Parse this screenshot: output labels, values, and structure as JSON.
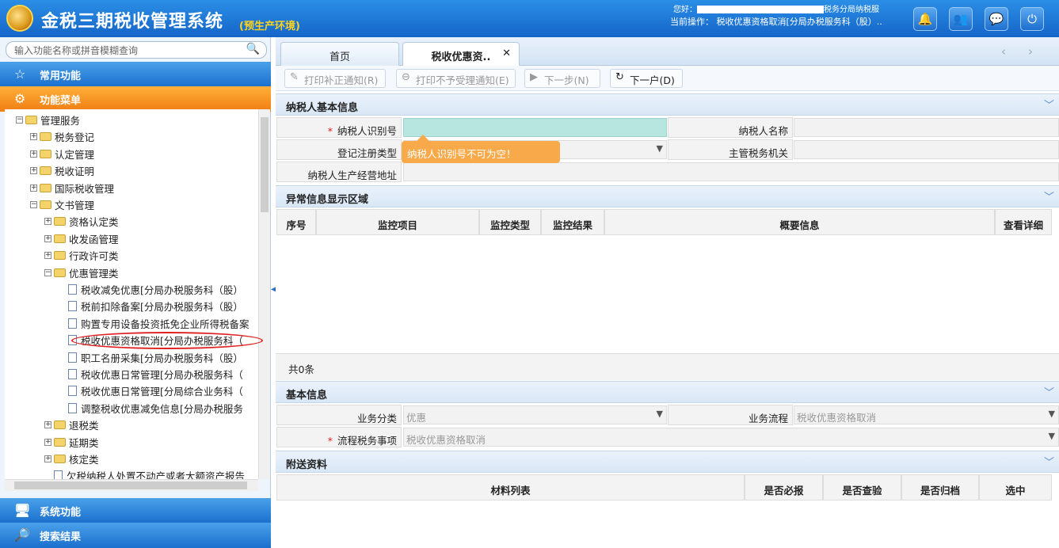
{
  "header": {
    "app_title": "金税三期税收管理系统",
    "env_tag": "(预生产环境)",
    "greeting": "您好：",
    "org_suffix": "税务分局纳税服",
    "current_op_label": "当前操作：",
    "current_op_value": "税收优惠资格取消[分局办税服务科（股）..",
    "icons": [
      "bell-icon",
      "users-icon",
      "chat-icon",
      "power-icon"
    ]
  },
  "sidebar": {
    "search_placeholder": "输入功能名称或拼音模糊查询",
    "sections": {
      "common": "常用功能",
      "menu": "功能菜单",
      "system": "系统功能",
      "search_results": "搜索结果"
    },
    "tree": [
      {
        "label": "管理服务",
        "level": 0,
        "type": "folder",
        "state": "expanded"
      },
      {
        "label": "税务登记",
        "level": 1,
        "type": "folder",
        "state": "collapsed"
      },
      {
        "label": "认定管理",
        "level": 1,
        "type": "folder",
        "state": "collapsed"
      },
      {
        "label": "税收证明",
        "level": 1,
        "type": "folder",
        "state": "collapsed"
      },
      {
        "label": "国际税收管理",
        "level": 1,
        "type": "folder",
        "state": "collapsed"
      },
      {
        "label": "文书管理",
        "level": 1,
        "type": "folder",
        "state": "expanded"
      },
      {
        "label": "资格认定类",
        "level": 2,
        "type": "folder",
        "state": "collapsed"
      },
      {
        "label": "收发函管理",
        "level": 2,
        "type": "folder",
        "state": "collapsed"
      },
      {
        "label": "行政许可类",
        "level": 2,
        "type": "folder",
        "state": "collapsed"
      },
      {
        "label": "优惠管理类",
        "level": 2,
        "type": "folder",
        "state": "expanded"
      },
      {
        "label": "税收减免优惠[分局办税服务科（股）",
        "level": 3,
        "type": "doc"
      },
      {
        "label": "税前扣除备案[分局办税服务科（股）",
        "level": 3,
        "type": "doc"
      },
      {
        "label": "购置专用设备投资抵免企业所得税备案",
        "level": 3,
        "type": "doc"
      },
      {
        "label": "税收优惠资格取消[分局办税服务科（",
        "level": 3,
        "type": "doc",
        "selected": true
      },
      {
        "label": "职工名册采集[分局办税服务科（股）",
        "level": 3,
        "type": "doc"
      },
      {
        "label": "税收优惠日常管理[分局办税服务科（",
        "level": 3,
        "type": "doc"
      },
      {
        "label": "税收优惠日常管理[分局综合业务科（",
        "level": 3,
        "type": "doc"
      },
      {
        "label": "调整税收优惠减免信息[分局办税服务",
        "level": 3,
        "type": "doc"
      },
      {
        "label": "退税类",
        "level": 2,
        "type": "folder",
        "state": "collapsed"
      },
      {
        "label": "延期类",
        "level": 2,
        "type": "folder",
        "state": "collapsed"
      },
      {
        "label": "核定类",
        "level": 2,
        "type": "folder",
        "state": "collapsed"
      },
      {
        "label": "欠税纳税人处置不动产或者大额资产报告",
        "level": 2,
        "type": "doc"
      }
    ]
  },
  "tabs": [
    {
      "label": "首页",
      "active": false
    },
    {
      "label": "税收优惠资..",
      "active": true,
      "closable": true
    }
  ],
  "toolbar": {
    "print_correction": "打印补正通知(R)",
    "print_reject": "打印不予受理通知(E)",
    "next_step": "下一步(N)",
    "next_household": "下一户(D)"
  },
  "taxpayer_info": {
    "title": "纳税人基本信息",
    "fields": {
      "tax_id_label": "纳税人识别号",
      "tax_id_value": "",
      "name_label": "纳税人名称",
      "name_value": "",
      "reg_type_label": "登记注册类型",
      "reg_type_value": "",
      "tax_office_label": "主管税务机关",
      "tax_office_value": "",
      "address_label": "纳税人生产经营地址",
      "address_value": ""
    },
    "validation_tip": "纳税人识别号不可为空！"
  },
  "exception_area": {
    "title": "异常信息显示区域",
    "columns": [
      "序号",
      "监控项目",
      "监控类型",
      "监控结果",
      "概要信息",
      "查看详细"
    ],
    "rows": [],
    "count_text": "共0条"
  },
  "basic_info": {
    "title": "基本信息",
    "business_category_label": "业务分类",
    "business_category_value": "优惠",
    "business_flow_label": "业务流程",
    "business_flow_value": "税收优惠资格取消",
    "flow_item_label": "流程税务事项",
    "flow_item_value": "税收优惠资格取消"
  },
  "attachments": {
    "title": "附送资料",
    "columns": [
      "材料列表",
      "是否必报",
      "是否查验",
      "是否归档",
      "选中"
    ]
  },
  "colors": {
    "header_blue": "#1a74d4",
    "accent_orange": "#f28c1c",
    "tip_orange": "#f8a94a",
    "required_red": "#e02020",
    "input_teal": "#b7e6e0"
  }
}
